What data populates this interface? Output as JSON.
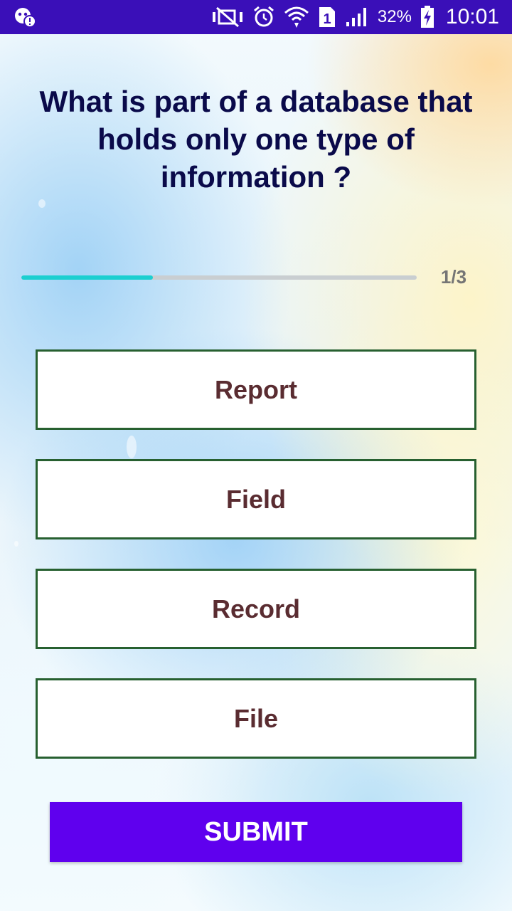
{
  "status_bar": {
    "battery_percent": "32%",
    "time": "10:01",
    "sim_slot": "1",
    "icons": [
      "notification-icon",
      "mute-icon",
      "alarm-icon",
      "wifi-icon",
      "sim-icon",
      "signal-icon",
      "battery-charging-icon"
    ],
    "background_color": "#3a0fb8"
  },
  "quiz": {
    "question": "What is part of a database that holds only one type of information ?",
    "progress": {
      "label": "1/3",
      "fraction": 0.333,
      "fill_color": "#1ccfd0"
    },
    "options": [
      "Report",
      "Field",
      "Record",
      "File"
    ],
    "option_border_color": "#276030",
    "option_text_color": "#5a2c31",
    "submit_label": "SUBMIT",
    "submit_color": "#5f00ee"
  }
}
